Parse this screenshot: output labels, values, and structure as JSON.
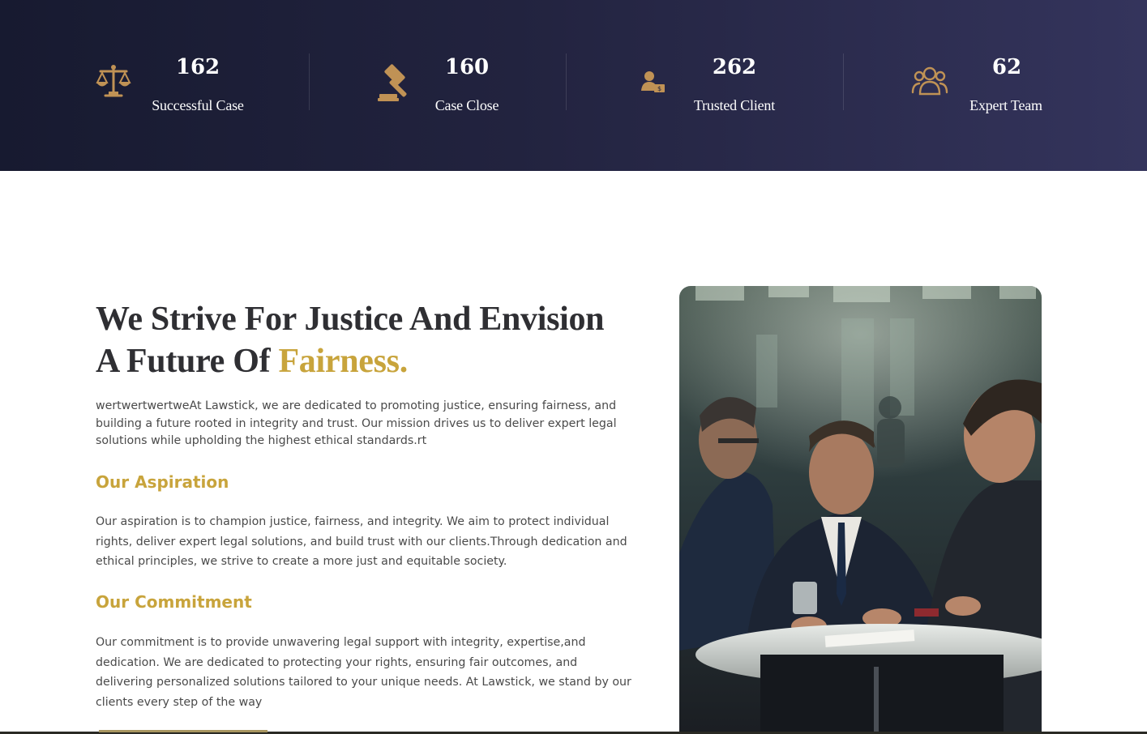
{
  "stats": [
    {
      "icon": "scales-of-justice-icon",
      "value": "162",
      "label": "Successful Case"
    },
    {
      "icon": "gavel-icon",
      "value": "160",
      "label": "Case Close"
    },
    {
      "icon": "client-person-icon",
      "value": "262",
      "label": "Trusted Client"
    },
    {
      "icon": "team-people-icon",
      "value": "62",
      "label": "Expert Team"
    }
  ],
  "about": {
    "headline_line1": "We Strive For Justice And Envision",
    "headline_line2_prefix": "A Future Of ",
    "headline_accent": "Fairness.",
    "intro": "wertwertwertweAt Lawstick, we are dedicated to promoting justice, ensuring fairness, and building a future rooted in integrity and trust. Our mission drives us to deliver expert legal solutions while upholding the highest ethical standards.rt",
    "aspiration_title": "Our Aspiration",
    "aspiration_text": "Our aspiration is to champion justice, fairness, and integrity. We aim to protect individual rights, deliver expert legal solutions, and build trust with our clients.Through dedication and ethical principles, we strive to create a more just and equitable society.",
    "commitment_title": "Our Commitment",
    "commitment_text": "Our commitment is to provide unwavering legal support with integrity, expertise,and dedication. We are dedicated to protecting your rights, ensuring fair outcomes, and delivering personalized solutions tailored to your unique needs. At Lawstick, we stand by our clients every step of the way"
  },
  "colors": {
    "accent": "#c8a43c",
    "icon_bronze": "#c09255",
    "band_dark": "#171a30",
    "band_light": "#34345c"
  }
}
